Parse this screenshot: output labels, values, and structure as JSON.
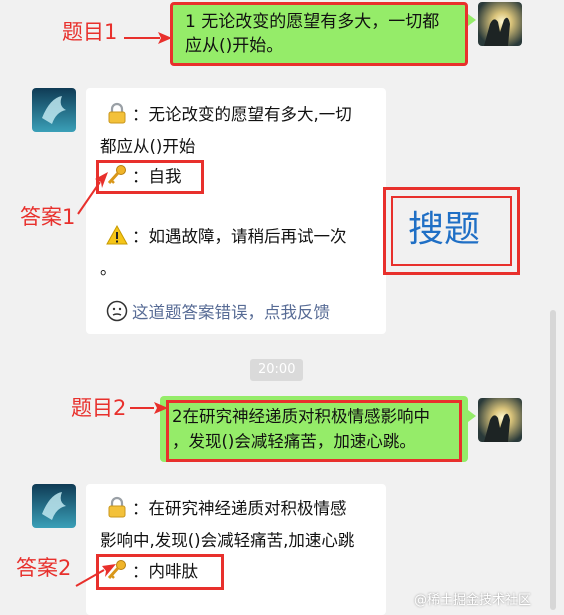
{
  "messages": {
    "q1": {
      "label": "题目1",
      "text": "1 无论改变的愿望有多大，一切都应从()开始。"
    },
    "a1": {
      "label": "答案1",
      "question_line1": "：无论改变的愿望有多大,一切",
      "question_line2": "都应从()开始",
      "answer": "：自我",
      "warning_line1": "：如遇故障，请稍后再试一次",
      "warning_line2": "。",
      "feedback": "这道题答案错误，点我反馈",
      "search_label": "搜题"
    },
    "time": "20:00",
    "q2": {
      "label": "题目2",
      "line1": "2在研究神经递质对积极情感影响中",
      "line2": "，发现()会减轻痛苦，加速心跳。"
    },
    "a2": {
      "label": "答案2",
      "question_line1": "：在研究神经递质对积极情感",
      "question_line2": "影响中,发现()会减轻痛苦,加速心跳",
      "answer": "：内啡肽"
    }
  },
  "watermark": "@稀土掘金技术社区",
  "icons": [
    "lock-icon",
    "key-icon",
    "warning-icon",
    "thinking-face-icon",
    "user-avatar",
    "bot-avatar"
  ],
  "colors": {
    "accent_red": "#e8302c",
    "bubble_green": "#95ec69",
    "search_blue": "#1f6fc5",
    "link_blue": "#576b95"
  }
}
